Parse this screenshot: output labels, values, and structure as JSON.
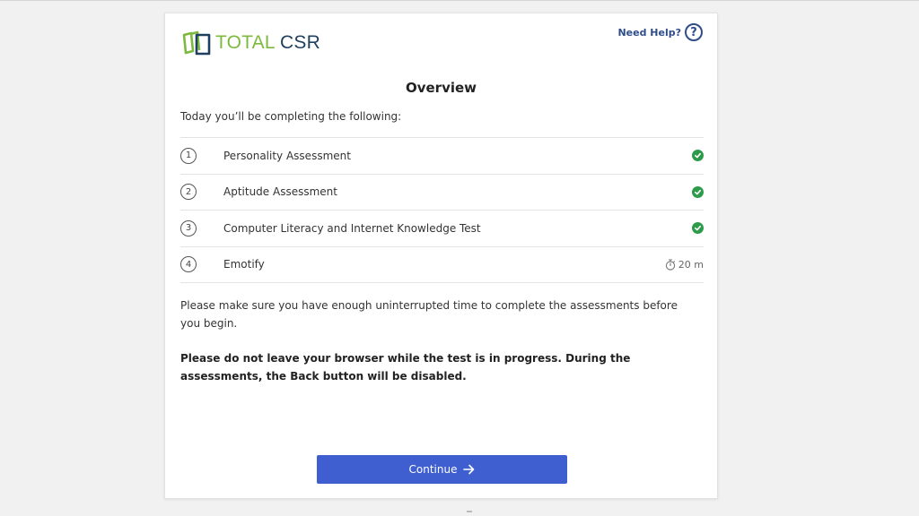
{
  "brand": {
    "name_part1": "TOTAL",
    "name_part2": "CSR",
    "colors": {
      "green": "#7cb93e",
      "navy": "#1f3f5f",
      "accent": "#3f5fd0",
      "success": "#2e9b4a"
    }
  },
  "header": {
    "help_label": "Need Help?",
    "help_icon": "question-circle-icon",
    "help_icon_glyph": "?"
  },
  "main": {
    "title": "Overview",
    "intro": "Today you’ll be completing the following:",
    "assessments": [
      {
        "number": "1",
        "label": "Personality Assessment",
        "status": "completed",
        "status_icon": "check-circle-icon"
      },
      {
        "number": "2",
        "label": "Aptitude Assessment",
        "status": "completed",
        "status_icon": "check-circle-icon"
      },
      {
        "number": "3",
        "label": "Computer Literacy and Internet Knowledge Test",
        "status": "completed",
        "status_icon": "check-circle-icon"
      },
      {
        "number": "4",
        "label": "Emotify",
        "status": "pending",
        "status_icon": "stopwatch-icon",
        "duration": "20 m"
      }
    ],
    "note": "Please make sure you have enough uninterrupted time to complete the assessments before you begin.",
    "warning": "Please do not leave your browser while the test is in progress. During the assessments, the Back button will be disabled."
  },
  "footer": {
    "continue_label": "Continue",
    "continue_icon": "arrow-right-icon"
  }
}
